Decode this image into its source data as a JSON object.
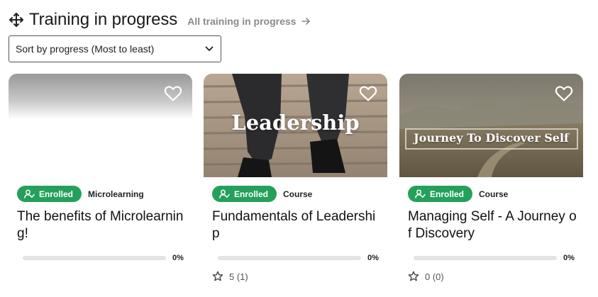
{
  "header": {
    "title": "Training in progress",
    "all_link": "All training in progress"
  },
  "sort": {
    "selected": "Sort by progress (Most to least)"
  },
  "cards": [
    {
      "badge": "Enrolled",
      "type": "Microlearning",
      "title": "The benefits of Microlearning!",
      "progress_label": "0%",
      "progress": 0,
      "image_text": ""
    },
    {
      "badge": "Enrolled",
      "type": "Course",
      "title": "Fundamentals of Leadership",
      "progress_label": "0%",
      "progress": 0,
      "image_text": "Leadership",
      "rating": "5 (1)"
    },
    {
      "badge": "Enrolled",
      "type": "Course",
      "title": "Managing Self - A Journey of Discovery",
      "progress_label": "0%",
      "progress": 0,
      "image_text": "Journey To Discover Self",
      "rating": "0 (0)"
    }
  ],
  "colors": {
    "accent": "#24a05a",
    "muted": "#8a8a8a"
  }
}
